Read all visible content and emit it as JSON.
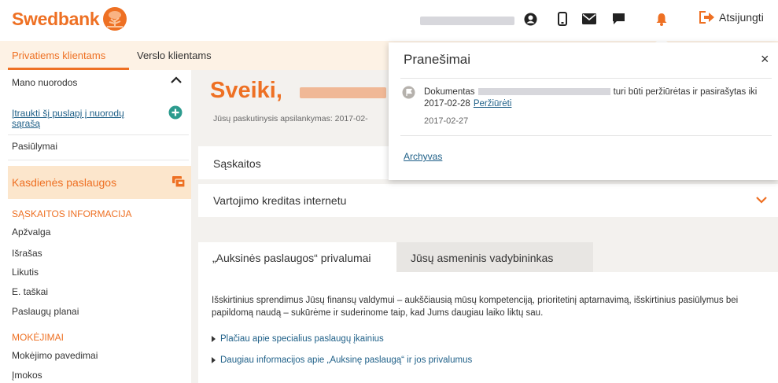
{
  "header": {
    "brand": "Swedbank",
    "logout_label": "Atsijungti",
    "icons": [
      "user-icon",
      "mobile-icon",
      "mail-icon",
      "chat-icon",
      "bell-icon",
      "logout-icon"
    ],
    "colors": {
      "brand": "#ee7023",
      "link": "#1f6088",
      "tint": "#fdf2e5"
    }
  },
  "tabs": {
    "private": "Privatiems klientams",
    "business": "Verslo klientams"
  },
  "sidebar": {
    "shortcuts": "Mano nuorodos",
    "add_shortcut": "Įtraukti šį puslapį į nuorodų sąrašą",
    "offers": "Pasiūlymai",
    "section": "Kasdienės paslaugos",
    "account_heading": "SĄSKAITOS INFORMACIJA",
    "account_items": [
      "Apžvalga",
      "Išrašas",
      "Likutis",
      "E. taškai",
      "Paslaugų planai"
    ],
    "payments_heading": "MOKĖJIMAI",
    "payment_items": [
      "Mokėjimo pavedimai",
      "Įmokos"
    ]
  },
  "main": {
    "greeting": "Sveiki,",
    "last_visit": "Jūsų paskutinysis apsilankymas: 2017-02-",
    "accounts": "Sąskaitos",
    "credit": "Vartojimo kreditas internetu",
    "tab_active": "„Auksinės paslaugos“ privalumai",
    "tab_inactive": "Jūsų asmeninis vadybininkas",
    "description": "Išskirtinius sprendimus Jūsų finansų valdymui – aukščiausią mūsų kompetenciją, prioritetinį aptarnavimą, išskirtinius pasiūlymus bei papildomą naudą – sukūrėme ir suderinome taip, kad Jums daugiau laiko liktų sau.",
    "link1": "Plačiau apie specialius paslaugų įkainius",
    "link2": "Daugiau informacijos apie „Auksinę paslaugą“ ir jos privalumus"
  },
  "popup": {
    "title": "Pranešimai",
    "close": "×",
    "doc_prefix": "Dokumentas",
    "doc_suffix": "turi būti peržiūrėtas ir pasirašytas iki 2017-02-28",
    "view_link": "Peržiūrėti",
    "date": "2017-02-27",
    "archive": "Archyvas"
  }
}
